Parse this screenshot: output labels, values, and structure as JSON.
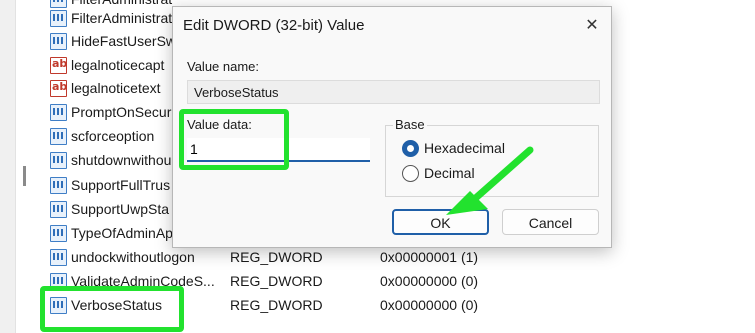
{
  "registry_rows": [
    {
      "name": "FilterAdministrat",
      "type": "",
      "data": "",
      "icon": "binary-value-icon"
    },
    {
      "name": "HideFastUserSw",
      "type": "",
      "data": "",
      "icon": "binary-value-icon"
    },
    {
      "name": "legalnoticecapt",
      "type": "",
      "data": "",
      "icon": "string-value-icon"
    },
    {
      "name": "legalnoticetext",
      "type": "",
      "data": "",
      "icon": "string-value-icon"
    },
    {
      "name": "PromptOnSecur",
      "type": "",
      "data": "",
      "icon": "binary-value-icon"
    },
    {
      "name": "scforceoption",
      "type": "",
      "data": "",
      "icon": "binary-value-icon"
    },
    {
      "name": "shutdownwithou",
      "type": "",
      "data": "",
      "icon": "binary-value-icon"
    },
    {
      "name": "SupportFullTrus",
      "type": "",
      "data": "",
      "icon": "binary-value-icon"
    },
    {
      "name": "SupportUwpSta",
      "type": "",
      "data": "",
      "icon": "binary-value-icon"
    },
    {
      "name": "TypeOfAdminAp",
      "type": "",
      "data": "",
      "icon": "binary-value-icon"
    },
    {
      "name": "undockwithoutlogon",
      "type": "REG_DWORD",
      "data": "0x00000001 (1)",
      "icon": "binary-value-icon"
    },
    {
      "name": "ValidateAdminCodeS...",
      "type": "REG_DWORD",
      "data": "0x00000000 (0)",
      "icon": "binary-value-icon"
    },
    {
      "name": "VerboseStatus",
      "type": "REG_DWORD",
      "data": "0x00000000 (0)",
      "icon": "binary-value-icon"
    }
  ],
  "dialog": {
    "title": "Edit DWORD (32-bit) Value",
    "close_glyph": "✕",
    "value_name_label": "Value name:",
    "value_name": "VerboseStatus",
    "value_data_label": "Value data:",
    "value_data": "1",
    "base_label": "Base",
    "hexadecimal_label": "Hexadecimal",
    "decimal_label": "Decimal",
    "base_selected": "Hexadecimal",
    "ok_label": "OK",
    "cancel_label": "Cancel"
  },
  "colors": {
    "highlight": "#22e22e",
    "accent": "#1f5fa8"
  }
}
